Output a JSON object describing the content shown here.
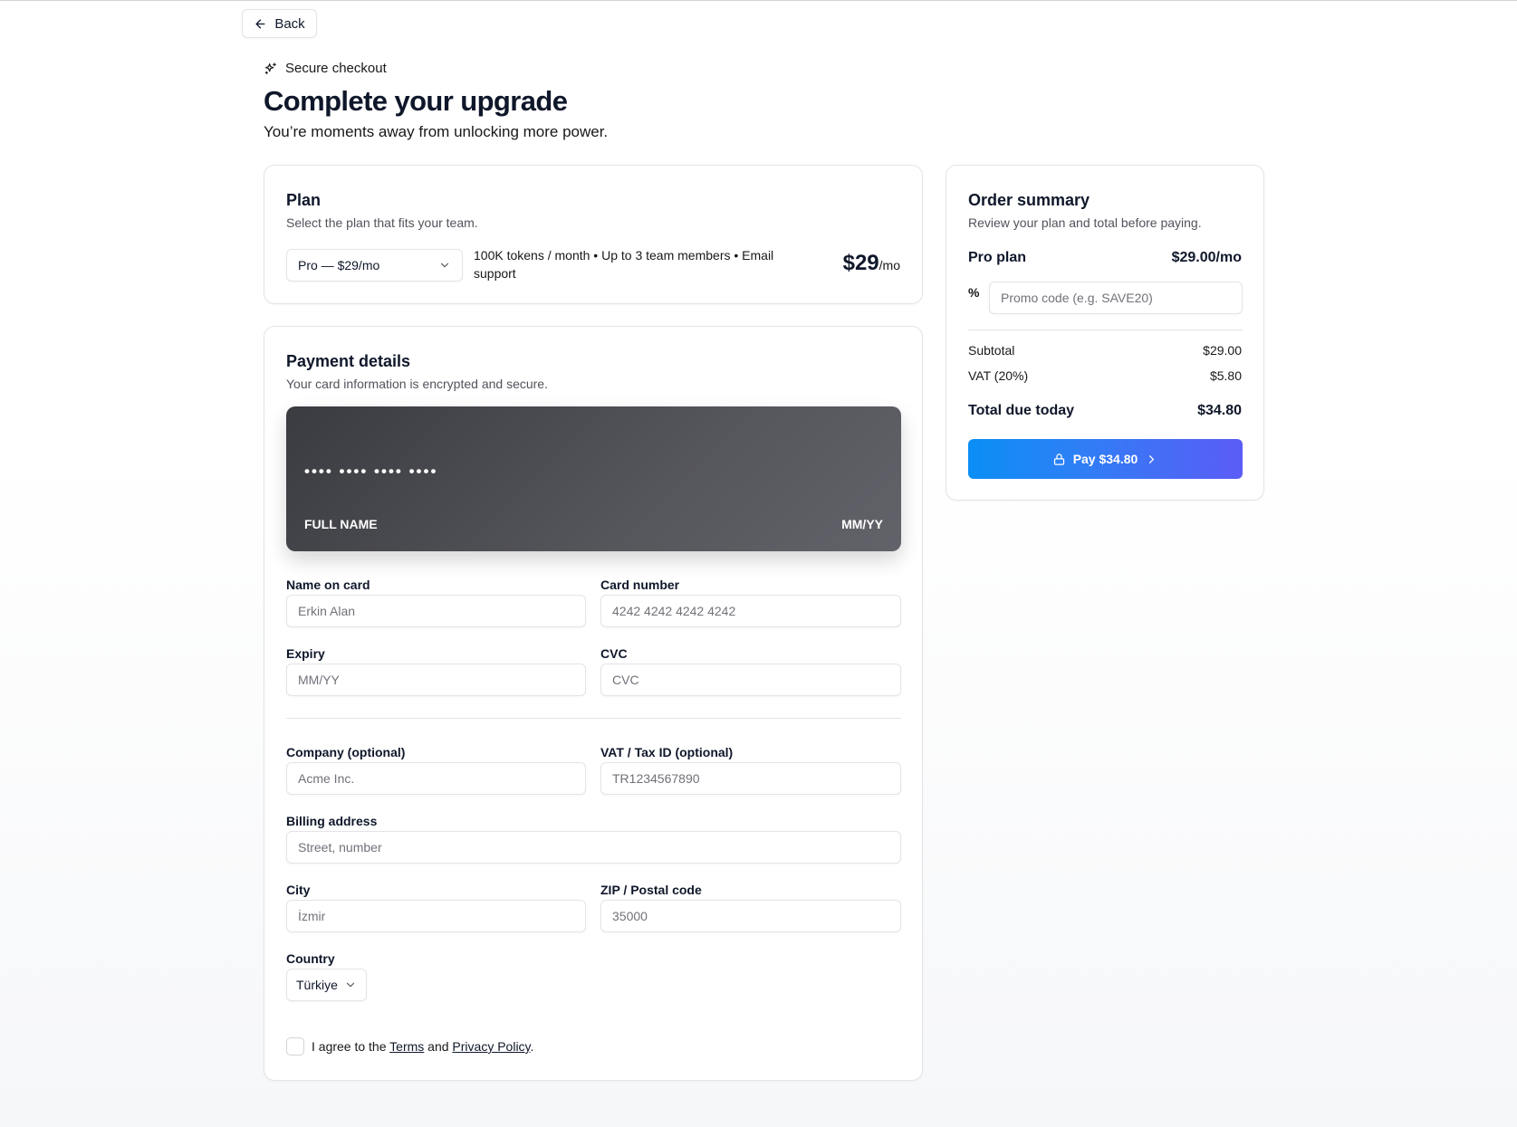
{
  "header": {
    "back_label": "Back",
    "eyebrow": "Secure checkout",
    "title": "Complete your upgrade",
    "subtitle": "You’re moments away from unlocking more power."
  },
  "plan": {
    "title": "Plan",
    "description": "Select the plan that fits your team.",
    "selected": "Pro — $29/mo",
    "features": "100K tokens / month • Up to 3 team members • Email support",
    "price_amount": "$29",
    "price_period": "/mo"
  },
  "payment": {
    "title": "Payment details",
    "description": "Your card information is encrypted and secure.",
    "card_preview": {
      "number": "•••• •••• •••• ••••",
      "name": "FULL NAME",
      "expiry": "MM/YY"
    },
    "fields": {
      "name": {
        "label": "Name on card",
        "placeholder": "Erkin Alan"
      },
      "number": {
        "label": "Card number",
        "placeholder": "4242 4242 4242 4242"
      },
      "expiry": {
        "label": "Expiry",
        "placeholder": "MM/YY"
      },
      "cvc": {
        "label": "CVC",
        "placeholder": "CVC"
      },
      "company": {
        "label": "Company (optional)",
        "placeholder": "Acme Inc."
      },
      "vat": {
        "label": "VAT / Tax ID (optional)",
        "placeholder": "TR1234567890"
      },
      "address": {
        "label": "Billing address",
        "placeholder": "Street, number"
      },
      "city": {
        "label": "City",
        "placeholder": "İzmir"
      },
      "zip": {
        "label": "ZIP / Postal code",
        "placeholder": "35000"
      },
      "country": {
        "label": "Country",
        "selected": "Türkiye"
      }
    },
    "agree": {
      "prefix": "I agree to the",
      "terms": "Terms",
      "and": "and",
      "privacy": "Privacy Policy",
      "suffix": "."
    }
  },
  "summary": {
    "title": "Order summary",
    "description": "Review your plan and total before paying.",
    "plan_label": "Pro plan",
    "plan_price": "$29.00/mo",
    "promo_icon": "%",
    "promo_placeholder": "Promo code (e.g. SAVE20)",
    "subtotal_label": "Subtotal",
    "subtotal_value": "$29.00",
    "vat_label": "VAT (20%)",
    "vat_value": "$5.80",
    "total_label": "Total due today",
    "total_value": "$34.80",
    "pay_label": "Pay $34.80"
  },
  "colors": {
    "pay_gradient_start": "#0a8ef5",
    "pay_gradient_end": "#5b5cf6",
    "card_preview_bg": "#3a3b40"
  },
  "icons": {
    "back": "arrow-left-icon",
    "eyebrow": "sparkles-icon",
    "select": "chevron-down-icon",
    "pay_lock": "lock-icon",
    "pay_arrow": "chevron-right-icon"
  }
}
